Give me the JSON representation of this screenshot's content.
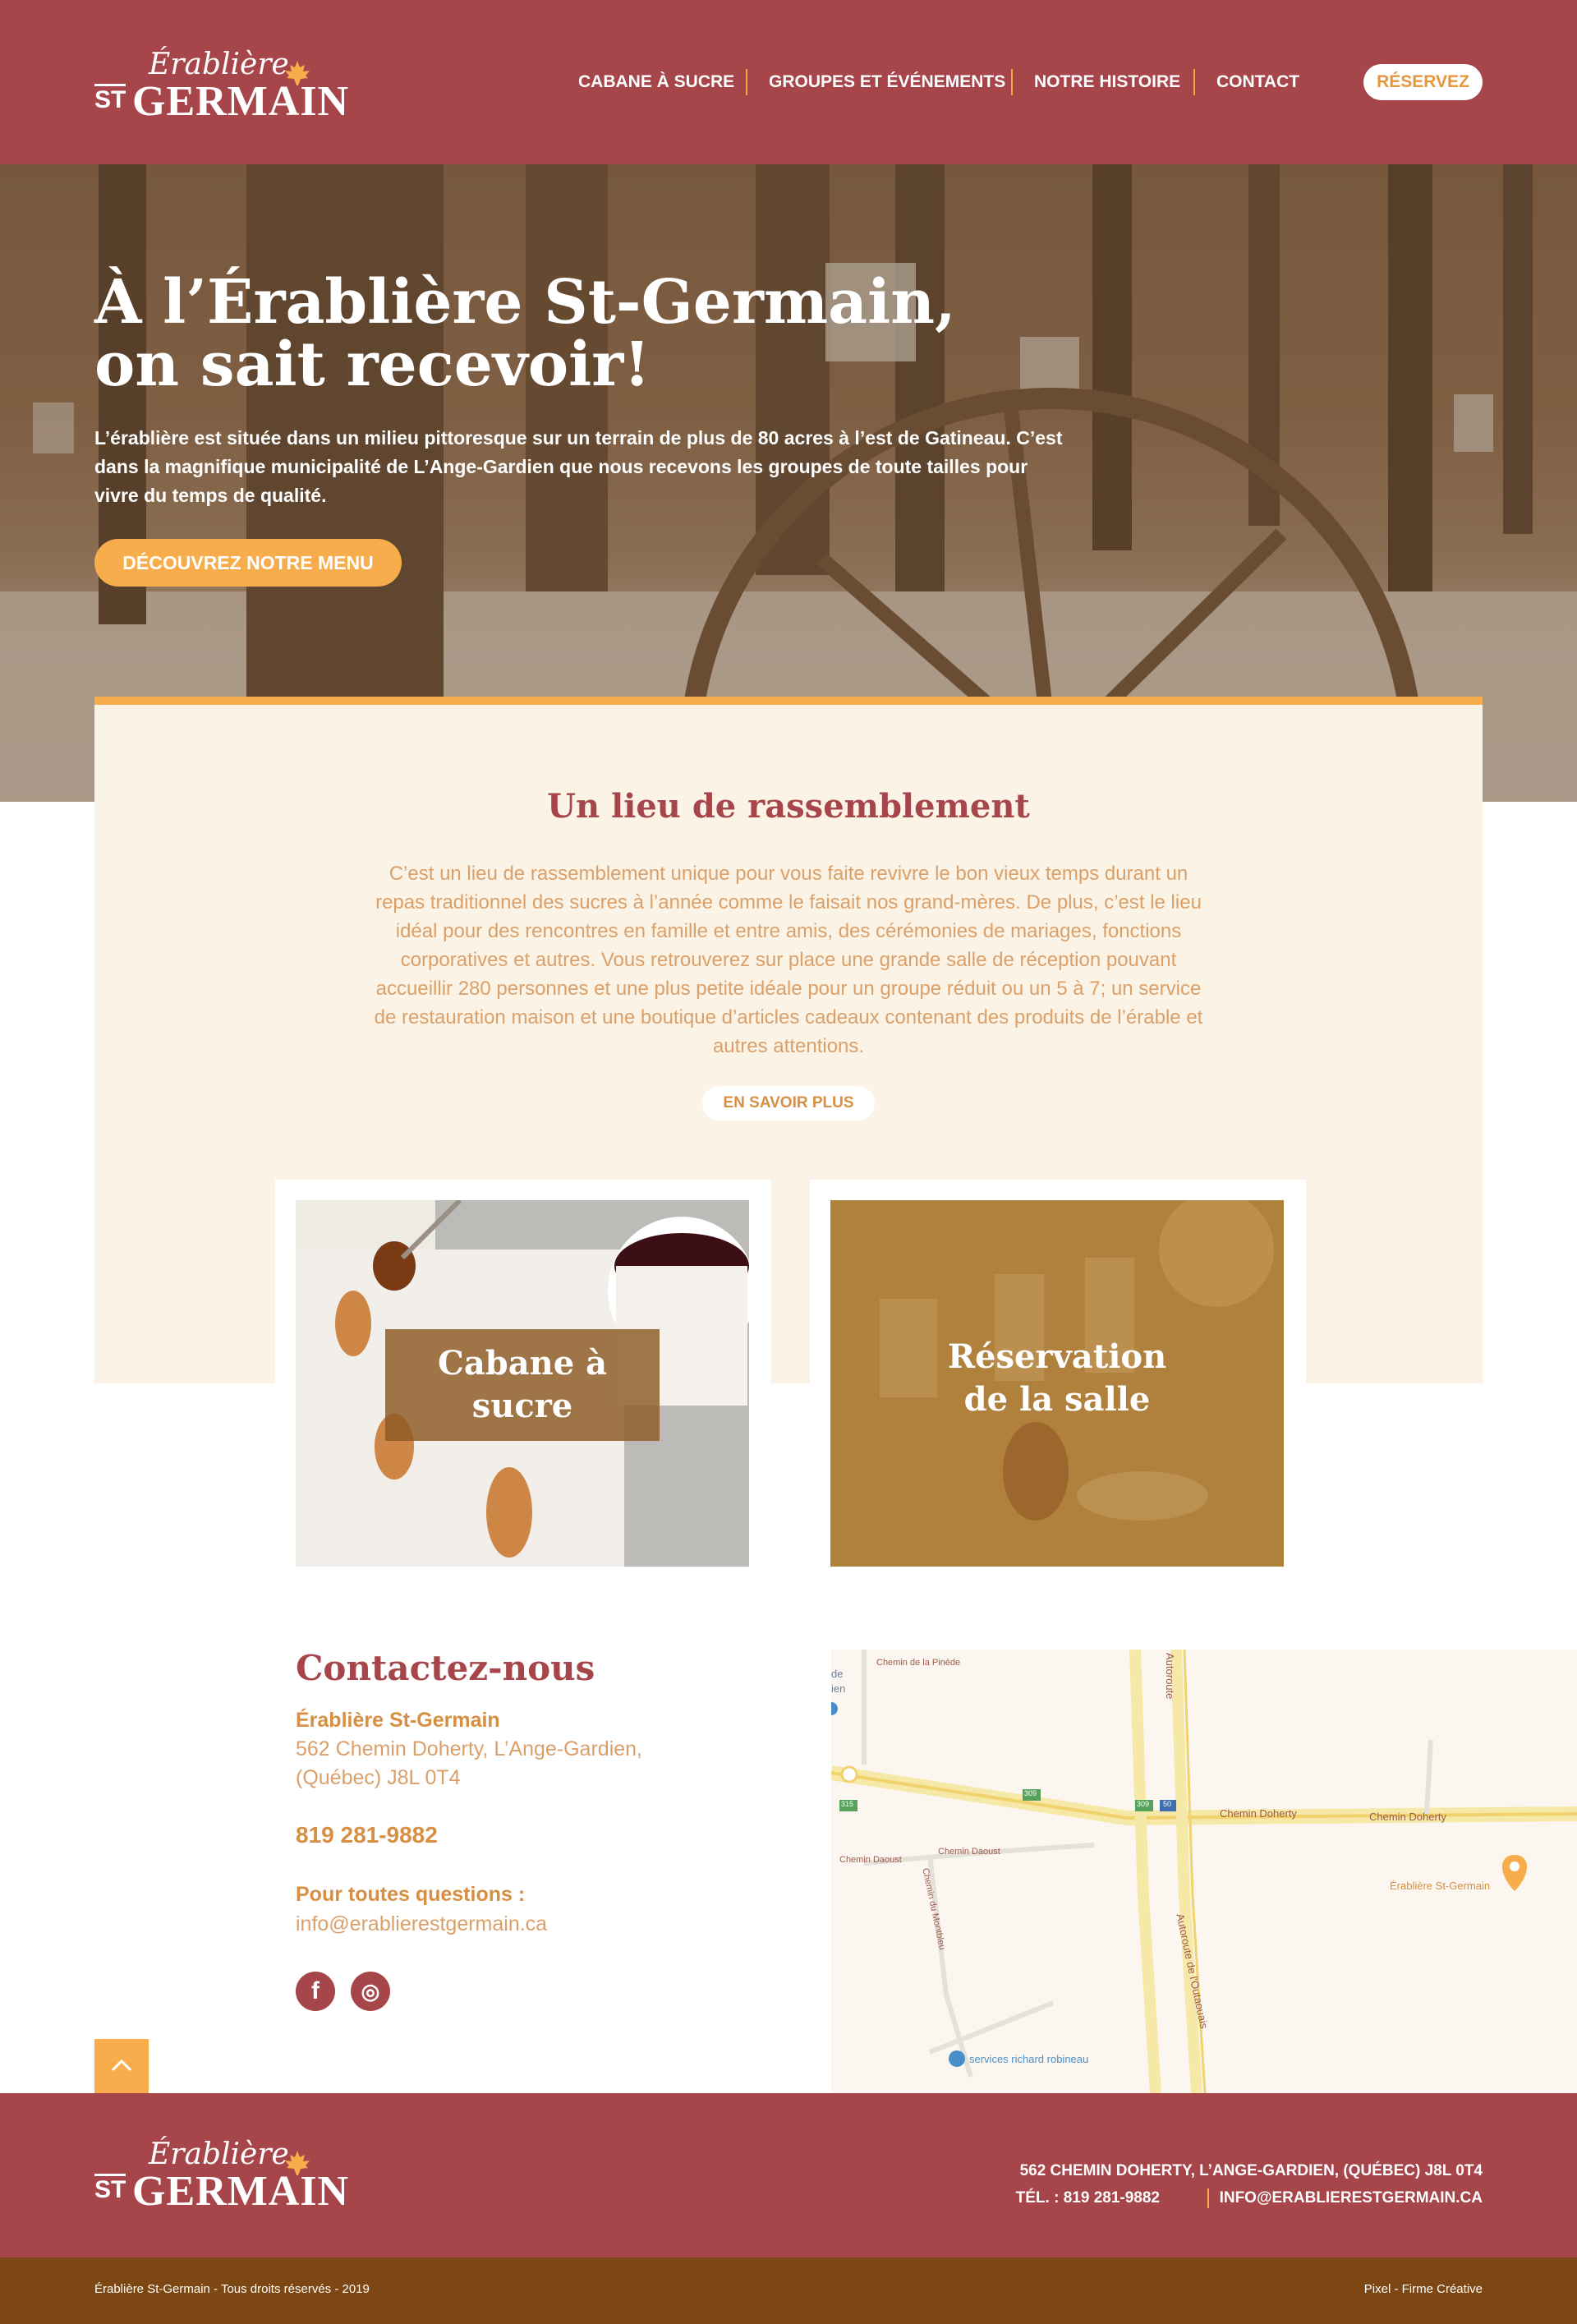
{
  "header": {
    "logo": {
      "script": "Érablière",
      "st": "ST",
      "name": "GERMAIN"
    },
    "nav": [
      "CABANE À SUCRE",
      "GROUPES ET ÉVÉNEMENTS",
      "NOTRE HISTOIRE",
      "CONTACT"
    ],
    "reserve_label": "RÉSERVEZ"
  },
  "hero": {
    "title_line1": "À l’Érablière St-Germain,",
    "title_line2": "on sait recevoir!",
    "text": "L’érablière est située dans un milieu pittoresque sur un terrain de plus de 80 acres à l’est de Gatineau. C’est dans la magnifique municipalité de L’Ange-Gardien que nous recevons les groupes de toute tailles pour vivre du temps de qualité.",
    "button_label": "DÉCOUVREZ NOTRE MENU"
  },
  "about": {
    "title": "Un lieu de rassemblement",
    "text": "C’est un lieu de rassemblement unique pour vous faite revivre le bon vieux temps durant un repas traditionnel des sucres à l’année comme le faisait nos grand-mères. De plus, c’est le lieu idéal pour des rencontres en famille et entre amis, des cérémonies de mariages, fonctions corporatives et autres. Vous retrouverez sur place une grande salle de réception pouvant accueillir 280 personnes et une plus petite idéale pour un groupe réduit ou un 5 à 7; un service de restauration maison et une boutique d’articles cadeaux contenant des produits de l’érable et autres attentions.",
    "button_label": "EN SAVOIR PLUS"
  },
  "tiles": [
    {
      "line1": "Cabane à",
      "line2": "sucre"
    },
    {
      "line1": "Réservation",
      "line2": "de la salle"
    }
  ],
  "contact": {
    "title": "Contactez-nous",
    "name": "Érablière St-Germain",
    "address1": "562 Chemin Doherty, L’Ange-Gardien,",
    "address2": "(Québec)  J8L 0T4",
    "phone": "819 281-9882",
    "questions_label": "Pour toutes questions :",
    "email": "info@erablierestgermain.ca",
    "social": [
      "f",
      "◎"
    ]
  },
  "map": {
    "labels": {
      "pinede": "Chemin de la Pinède",
      "de": "de",
      "ien": "ien",
      "autoroute_top": "Autoroute",
      "doherty1": "Chemin Doherty",
      "doherty2": "Chemin Doherty",
      "daoust1": "Chemin Daoust",
      "daoust2": "Chemin Daoust",
      "montbleu": "Chemin du Montbleu",
      "outaouais": "Autoroute de l'Outaouais",
      "pin": "Érablière St-Germain",
      "services": "services richard robineau",
      "r315": "315",
      "r309a": "309",
      "r309b": "309",
      "r50": "50"
    }
  },
  "footer": {
    "address": "562 CHEMIN DOHERTY, L’ANGE-GARDIEN, (QUÉBEC)  J8L 0T4",
    "phone": "TÉL. : 819 281-9882",
    "email": "INFO@ERABLIERESTGERMAIN.CA",
    "copyright": "Érablière St-Germain - Tous droits réservés - 2019",
    "credit": "Pixel - Firme Créative"
  },
  "colors": {
    "brand_red": "#a6454a",
    "accent_orange": "#f7ad4c",
    "cream": "#fbf3e6",
    "footer_brown": "#7c4712"
  }
}
